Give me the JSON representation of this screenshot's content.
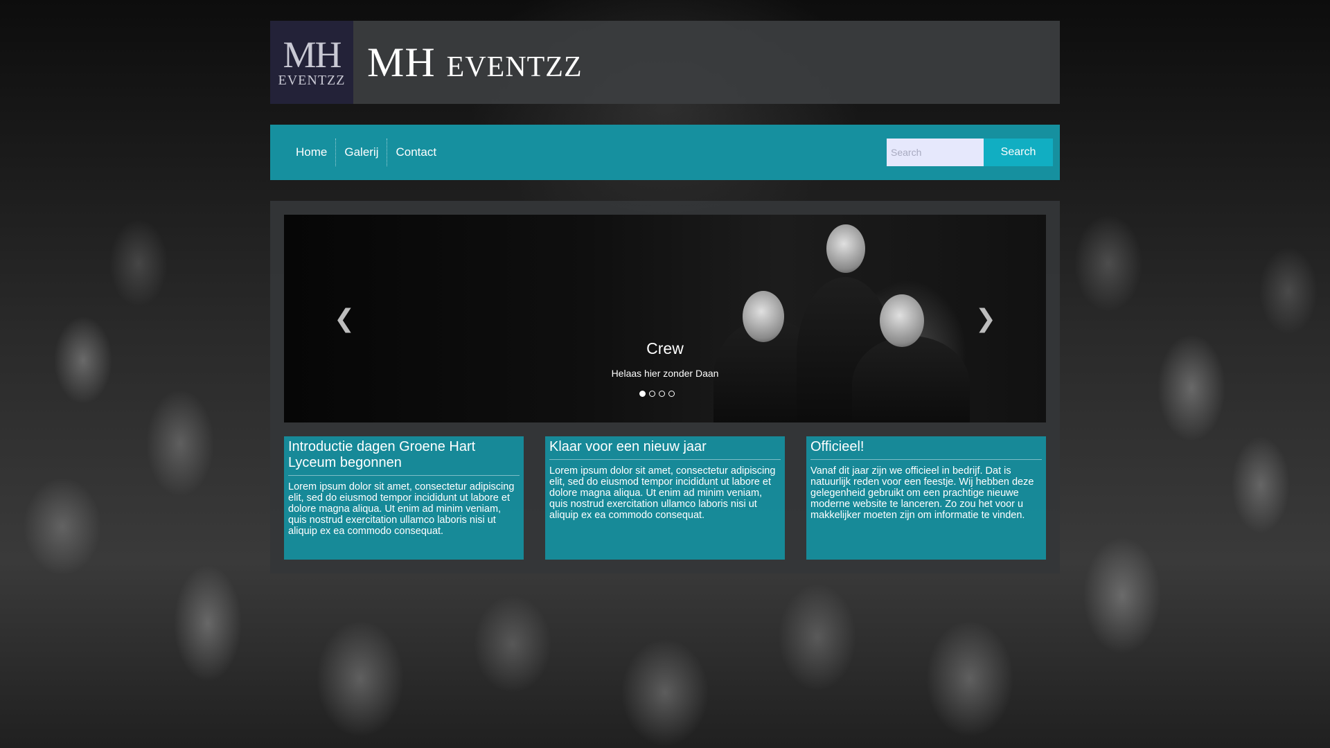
{
  "brand": {
    "logo_mh": "MH",
    "logo_sub": "EVENTZZ",
    "title": "MH eventzz"
  },
  "nav": {
    "items": [
      "Home",
      "Galerij",
      "Contact"
    ],
    "search_placeholder": "Search",
    "search_button": "Search"
  },
  "carousel": {
    "title": "Crew",
    "text": "Helaas hier zonder Daan",
    "slide_count": 4,
    "active_index": 0,
    "prev_icon": "chevron-left-icon",
    "next_icon": "chevron-right-icon"
  },
  "cards": [
    {
      "title": "Introductie dagen Groene Hart Lyceum begonnen",
      "text": "Lorem ipsum dolor sit amet, consectetur adipiscing elit, sed do eiusmod tempor incididunt ut labore et dolore magna aliqua. Ut enim ad minim veniam, quis nostrud exercitation ullamco laboris nisi ut aliquip ex ea commodo consequat."
    },
    {
      "title": "Klaar voor een nieuw jaar",
      "text": "Lorem ipsum dolor sit amet, consectetur adipiscing elit, sed do eiusmod tempor incididunt ut labore et dolore magna aliqua. Ut enim ad minim veniam, quis nostrud exercitation ullamco laboris nisi ut aliquip ex ea commodo consequat."
    },
    {
      "title": "Officieel!",
      "text": "Vanaf dit jaar zijn we officieel in bedrijf. Dat is natuurlijk reden voor een feestje. Wij hebben deze gelegenheid gebruikt om een prachtige nieuwe moderne website te lanceren. Zo zou het voor u makkelijker moeten zijn om informatie te vinden."
    }
  ],
  "colors": {
    "accent": "#16909f",
    "search_button": "#11aec2",
    "header_bg": "#3c3e40"
  }
}
